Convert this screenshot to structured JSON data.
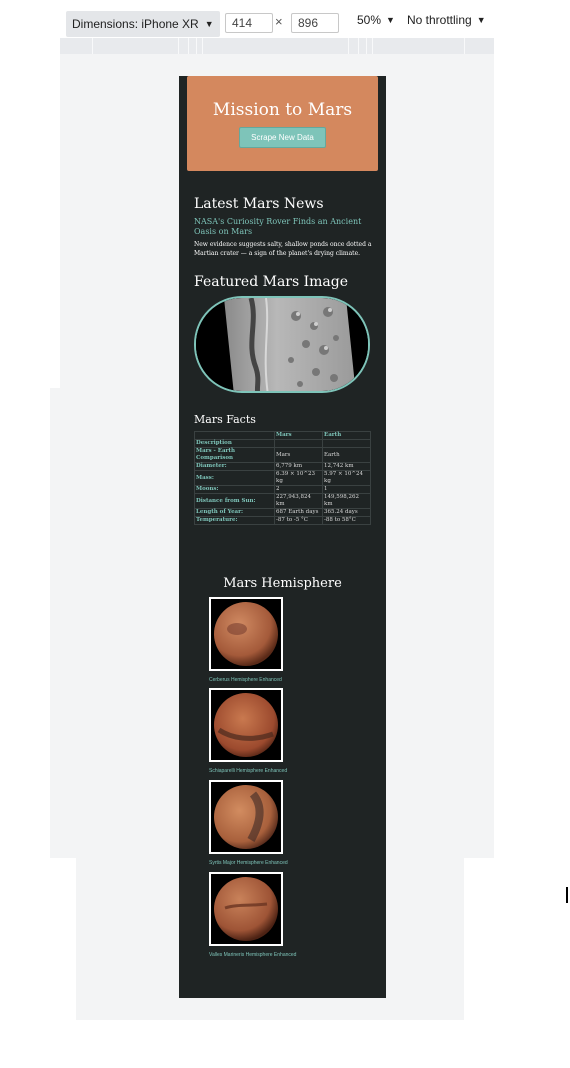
{
  "devtools": {
    "device_label": "Dimensions: iPhone XR",
    "width_value": "414",
    "times": "×",
    "height_value": "896",
    "zoom_label": "50%",
    "throttle_label": "No throttling"
  },
  "site": {
    "title": "Mission to Mars",
    "scrape_button": "Scrape New Data",
    "news_heading": "Latest Mars News",
    "news_title": "NASA's Curiosity Rover Finds an Ancient Oasis on Mars",
    "news_teaser": "New evidence suggests salty, shallow ponds once dotted a Martian crater — a sign of the planet's drying climate.",
    "image_heading": "Featured Mars Image",
    "facts_heading": "Mars Facts",
    "facts_columns": [
      "",
      "Mars",
      "Earth"
    ],
    "facts_rows": [
      [
        "Description",
        "",
        ""
      ],
      [
        "Mars - Earth Comparison",
        "Mars",
        "Earth"
      ],
      [
        "Diameter:",
        "6,779 km",
        "12,742 km"
      ],
      [
        "Mass:",
        "6.39 × 10^23 kg",
        "5.97 × 10^24 kg"
      ],
      [
        "Moons:",
        "2",
        "1"
      ],
      [
        "Distance from Sun:",
        "227,943,824 km",
        "149,598,262 km"
      ],
      [
        "Length of Year:",
        "687 Earth days",
        "365.24 days"
      ],
      [
        "Temperature:",
        "-87 to -5 °C",
        "-88 to 58°C"
      ]
    ],
    "hemi_heading": "Mars Hemisphere",
    "hemispheres": [
      {
        "caption": "Cerberus Hemisphere Enhanced",
        "color": "#b8694a"
      },
      {
        "caption": "Schiaparelli Hemisphere Enhanced",
        "color": "#a9563a"
      },
      {
        "caption": "Syrtis Major Hemisphere Enhanced",
        "color": "#b06a45"
      },
      {
        "caption": "Valles Marineris Hemisphere Enhanced",
        "color": "#a65a3c"
      }
    ]
  },
  "colors": {
    "accent_orange": "#d4885e",
    "accent_teal": "#7ec4b9",
    "page_dark": "#1f2424"
  }
}
